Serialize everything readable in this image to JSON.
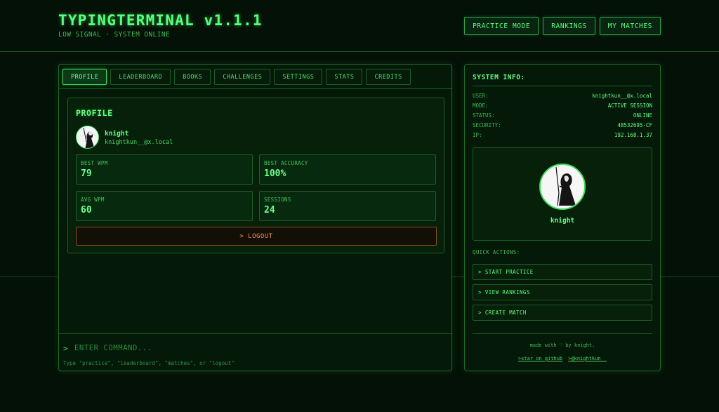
{
  "header": {
    "title": "TYPINGTERMINAL v1.1.1",
    "subtitle": "LOW SIGNAL · SYSTEM ONLINE",
    "nav": [
      "PRACTICE MODE",
      "RANKINGS",
      "MY MATCHES"
    ]
  },
  "tabs": [
    "PROFILE",
    "LEADERBOARD",
    "BOOKS",
    "CHALLENGES",
    "SETTINGS",
    "STATS",
    "CREDITS"
  ],
  "active_tab": "PROFILE",
  "profile": {
    "heading": "PROFILE",
    "name": "knight",
    "email": "knightkun__@x.local",
    "stats": [
      {
        "label": "BEST WPM",
        "value": "79"
      },
      {
        "label": "BEST ACCURACY",
        "value": "100%"
      },
      {
        "label": "AVG WPM",
        "value": "60"
      },
      {
        "label": "SESSIONS",
        "value": "24"
      }
    ],
    "logout_label": "> LOGOUT"
  },
  "command": {
    "prompt": ">",
    "placeholder": "ENTER COMMAND...",
    "hint": "Type \"practice\", \"leaderboard\", \"matches\", or \"logout\""
  },
  "system_info": {
    "title": "SYSTEM INFO:",
    "rows": [
      {
        "key": "USER:",
        "value": "knightkun__@x.local"
      },
      {
        "key": "MODE:",
        "value": "ACTIVE SESSION"
      },
      {
        "key": "STATUS:",
        "value": "ONLINE"
      },
      {
        "key": "SECURITY:",
        "value": "48532695-CF"
      },
      {
        "key": "IP:",
        "value": "192.168.1.37"
      }
    ],
    "avatar_name": "knight"
  },
  "quick_actions": {
    "title": "QUICK ACTIONS:",
    "items": [
      "> START PRACTICE",
      "> VIEW RANKINGS",
      "> CREATE MATCH"
    ]
  },
  "footer": {
    "text": "made with ♡ by knight.",
    "links": [
      ">star on github",
      ">@knightkun__"
    ]
  },
  "colors": {
    "background": "#041106",
    "accent": "#3ddc5b",
    "logout": "#ff8c52"
  }
}
